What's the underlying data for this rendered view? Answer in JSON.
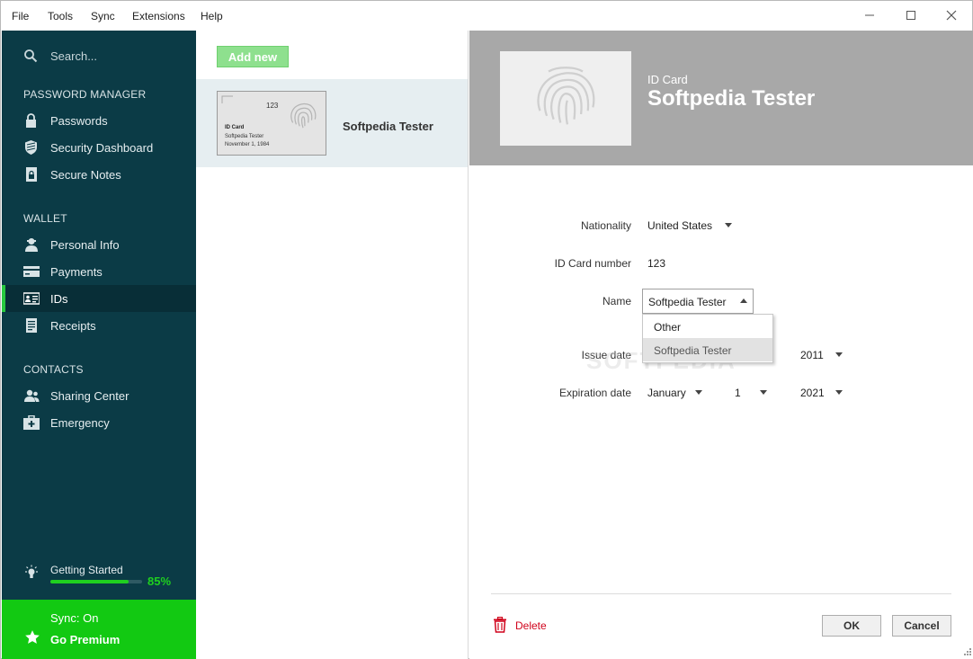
{
  "menu": {
    "file": "File",
    "tools": "Tools",
    "sync": "Sync",
    "extensions": "Extensions",
    "help": "Help"
  },
  "window_controls": {
    "minimize": "—",
    "maximize": "☐",
    "close": "✕"
  },
  "sidebar": {
    "search_placeholder": "Search...",
    "sections": {
      "password_manager": "PASSWORD MANAGER",
      "wallet": "WALLET",
      "contacts": "CONTACTS"
    },
    "items": [
      {
        "label": "Passwords",
        "icon": "lock-icon"
      },
      {
        "label": "Security Dashboard",
        "icon": "shield-icon"
      },
      {
        "label": "Secure Notes",
        "icon": "note-lock-icon"
      },
      {
        "label": "Personal Info",
        "icon": "person-icon"
      },
      {
        "label": "Payments",
        "icon": "credit-card-icon"
      },
      {
        "label": "IDs",
        "icon": "id-card-icon",
        "active": true
      },
      {
        "label": "Receipts",
        "icon": "receipt-icon"
      },
      {
        "label": "Sharing Center",
        "icon": "people-icon"
      },
      {
        "label": "Emergency",
        "icon": "first-aid-icon"
      }
    ],
    "getting_started": {
      "label": "Getting Started",
      "percent_text": "85%",
      "progress": 0.85
    },
    "sync_status": "Sync: On",
    "premium": "Go Premium"
  },
  "list": {
    "add_new": "Add new",
    "items": [
      {
        "name": "Softpedia Tester",
        "card_number": "123",
        "card_type": "ID Card",
        "card_name": "Softpedia Tester",
        "card_date": "November 1, 1984"
      }
    ]
  },
  "detail": {
    "type": "ID Card",
    "title": "Softpedia Tester",
    "fields": {
      "nationality_label": "Nationality",
      "nationality_value": "United States",
      "idnum_label": "ID Card number",
      "idnum_value": "123",
      "name_label": "Name",
      "name_value": "Softpedia Tester",
      "issue_label": "Issue date",
      "issue_year": "2011",
      "exp_label": "Expiration date",
      "exp_month": "January",
      "exp_day": "1",
      "exp_year": "2021"
    },
    "name_options": [
      "Other",
      "Softpedia Tester"
    ],
    "watermark": "SOFTPEDIA",
    "delete": "Delete",
    "ok": "OK",
    "cancel": "Cancel"
  },
  "colors": {
    "sidebar_bg": "#0b3b46",
    "accent_green": "#12c912",
    "delete_red": "#d0021b",
    "banner_gray": "#a8a8a8"
  }
}
